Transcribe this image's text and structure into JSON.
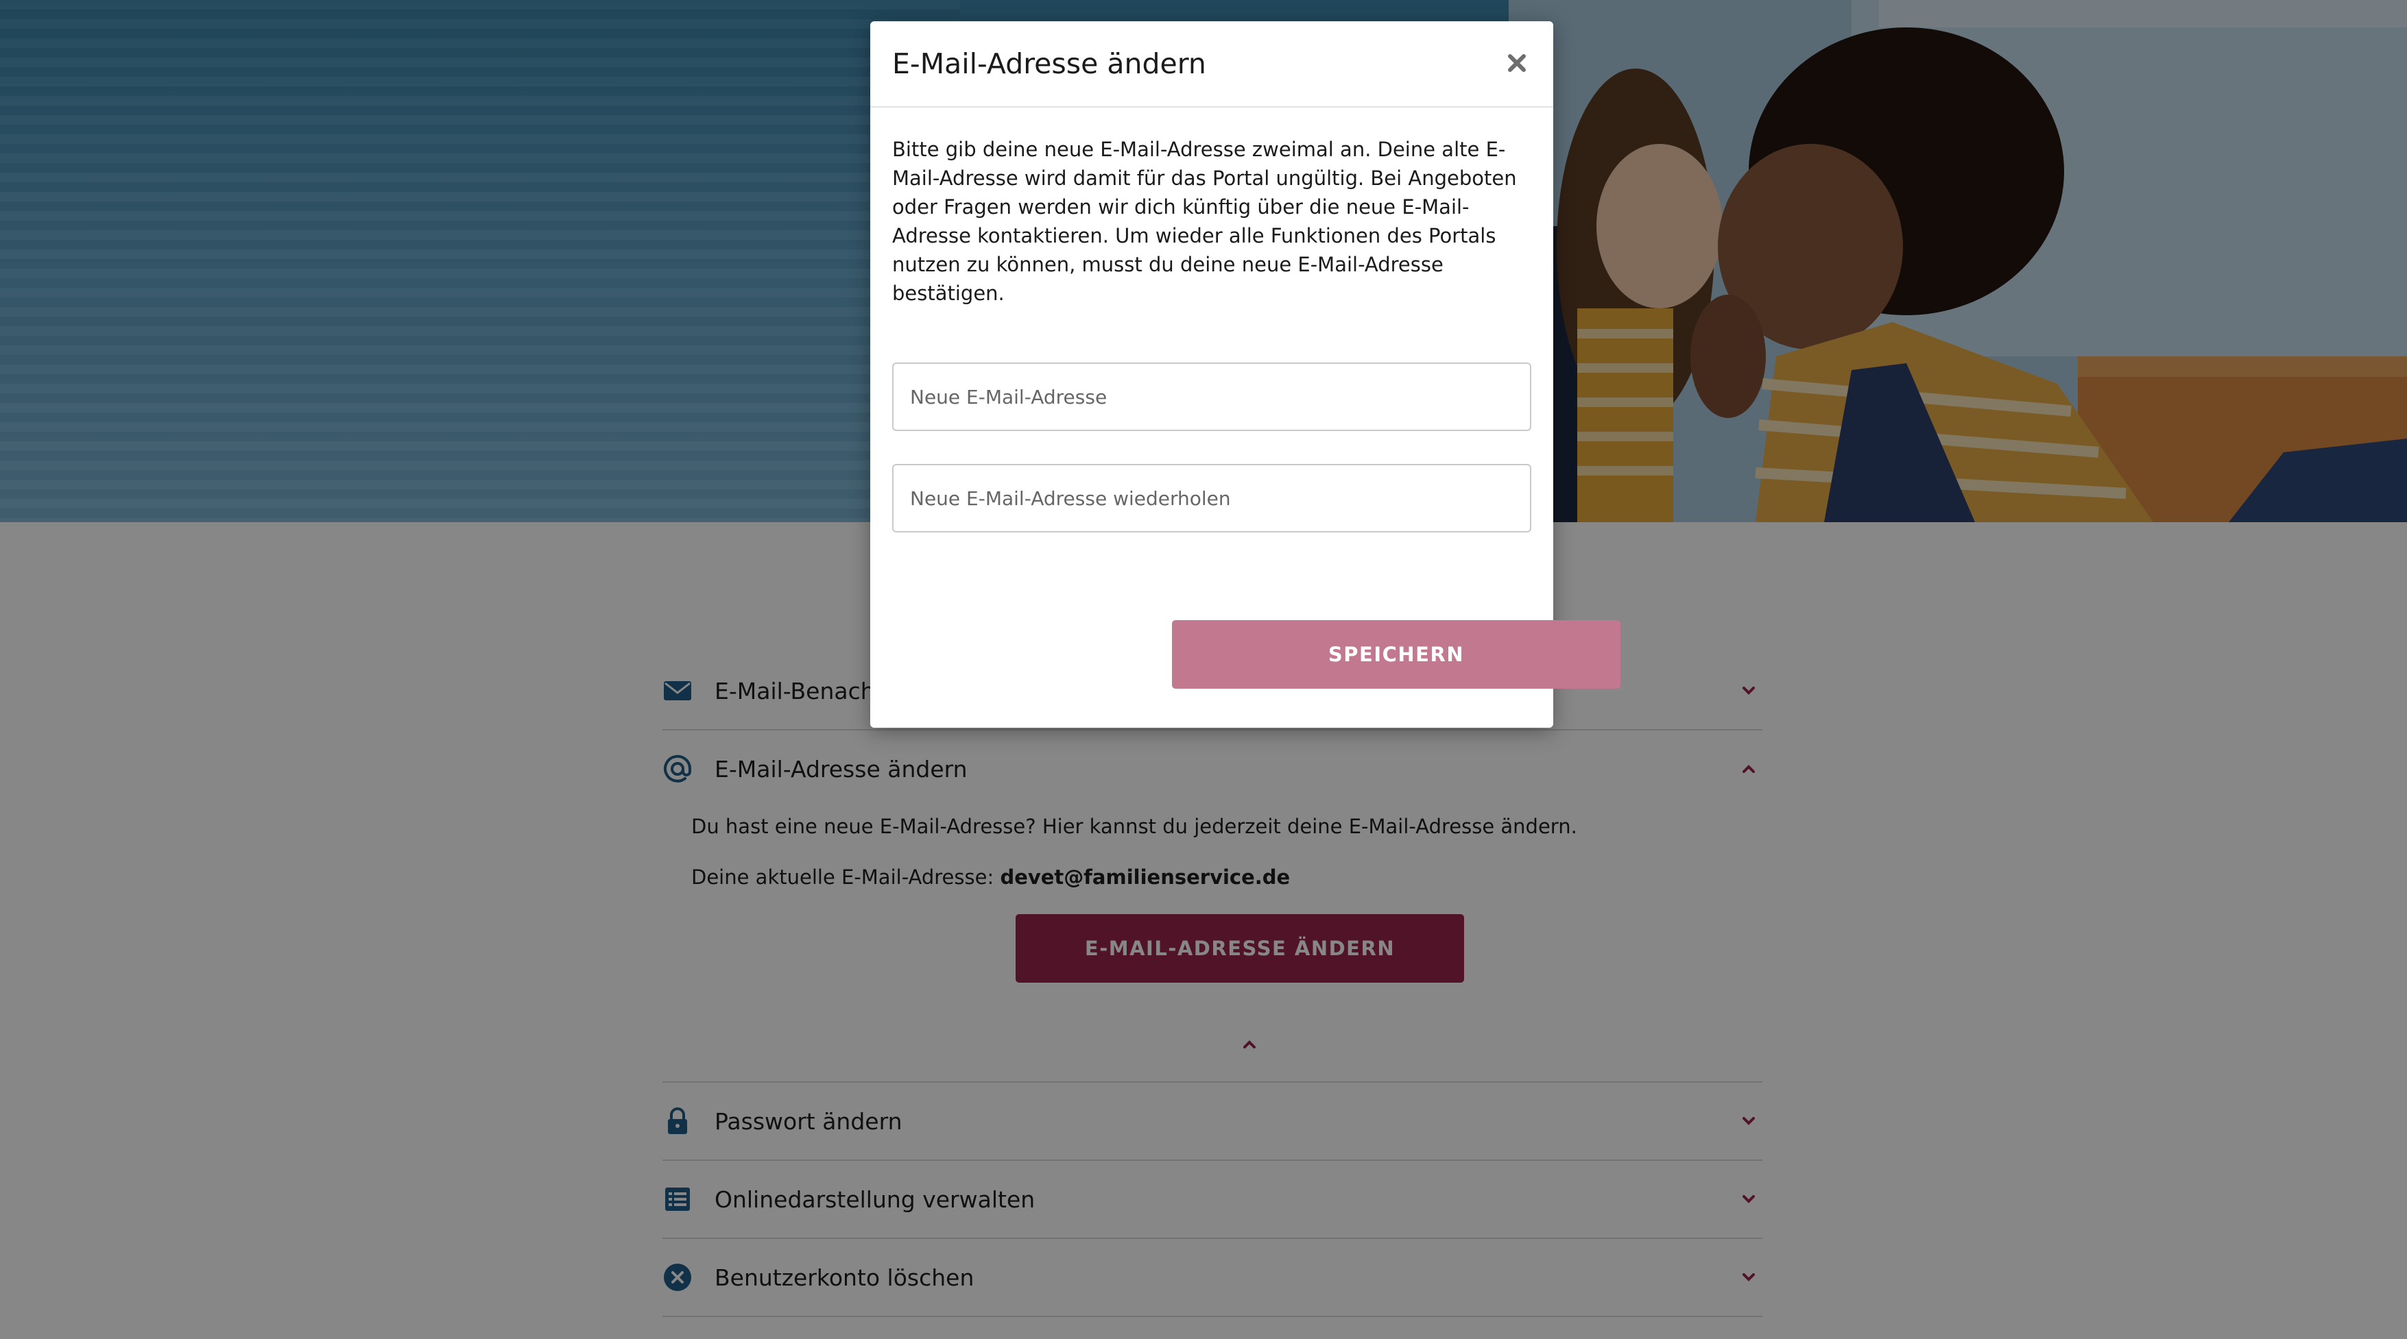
{
  "page": {
    "accent_color": "#99244a",
    "icon_color": "#1f5d86"
  },
  "accordion": {
    "items": [
      {
        "title": "E-Mail-Benachrichtigungen",
        "icon": "envelope-icon",
        "expanded": false
      },
      {
        "title": "E-Mail-Adresse ändern",
        "icon": "at-sign-icon",
        "expanded": true,
        "body_text": "Du hast eine neue E-Mail-Adresse? Hier kannst du jederzeit deine E-Mail-Adresse ändern.",
        "current_label": "Deine aktuelle E-Mail-Adresse:",
        "current_value": "devet@familienservice.de",
        "button_label": "E-MAIL-ADRESSE ÄNDERN"
      },
      {
        "title": "Passwort ändern",
        "icon": "lock-icon",
        "expanded": false
      },
      {
        "title": "Onlinedarstellung verwalten",
        "icon": "list-icon",
        "expanded": false
      },
      {
        "title": "Benutzerkonto löschen",
        "icon": "close-circle-icon",
        "expanded": false
      }
    ]
  },
  "modal": {
    "title": "E-Mail-Adresse ändern",
    "description": "Bitte gib deine neue E-Mail-Adresse zweimal an. Deine alte E-Mail-Adresse wird damit für das Portal ungültig. Bei Angeboten oder Fragen werden wir dich künftig über die neue E-Mail-Adresse kontaktieren. Um wieder alle Funktionen des Portals nutzen zu können, musst du deine neue E-Mail-Adresse bestätigen.",
    "email_placeholder": "Neue E-Mail-Adresse",
    "email_repeat_placeholder": "Neue E-Mail-Adresse wiederholen",
    "email_value": "",
    "email_repeat_value": "",
    "save_label": "SPEICHERN",
    "save_color": "#c2788f",
    "close_icon": "close-icon"
  }
}
